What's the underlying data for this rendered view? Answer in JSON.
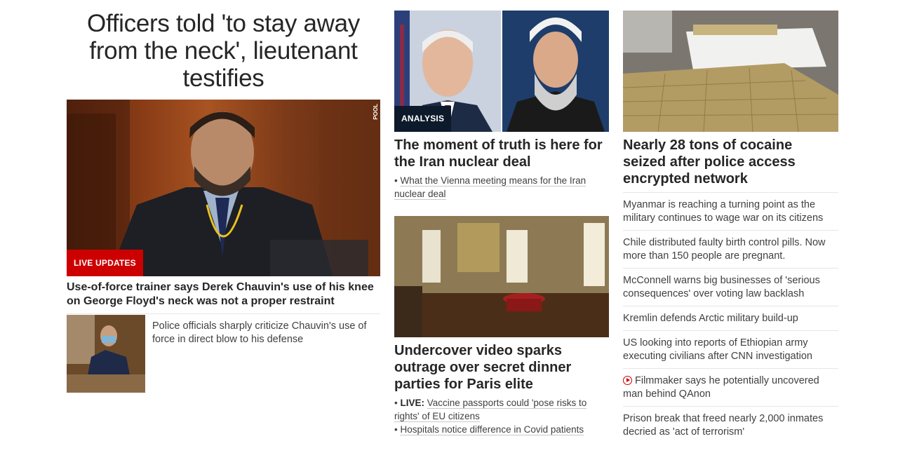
{
  "col1": {
    "headline": "Officers told 'to stay away from the neck', lieutenant testifies",
    "hero_badge": "LIVE UPDATES",
    "pool_label": "POOL",
    "sub_headline": "Use-of-force trainer says Derek Chauvin's use of his knee on George Floyd's neck was not a proper restraint",
    "thumb_text": "Police officials sharply criticize Chauvin's use of force in direct blow to his defense"
  },
  "col2": {
    "iran_badge": "ANALYSIS",
    "iran_headline": "The moment of truth is here for the Iran nuclear deal",
    "iran_bullet": "What the Vienna meeting means for the Iran nuclear deal",
    "paris_headline": "Undercover video sparks outrage over secret dinner parties for Paris elite",
    "paris_bullets": [
      {
        "prefix": "LIVE:",
        "text": "Vaccine passports could 'pose risks to rights' of EU citizens"
      },
      {
        "prefix": "",
        "text": "Hospitals notice difference in Covid patients"
      }
    ]
  },
  "col3": {
    "cocaine_headline": "Nearly 28 tons of cocaine seized after police access encrypted network",
    "items": [
      "Myanmar is reaching a turning point as the military continues to wage war on its citizens",
      "Chile distributed faulty birth control pills. Now more than 150 people are pregnant.",
      "McConnell warns big businesses of 'serious consequences' over voting law backlash",
      "Kremlin defends Arctic military build-up",
      "US looking into reports of Ethiopian army executing civilians after CNN investigation",
      "Filmmaker says he potentially uncovered man behind QAnon",
      "Prison break that freed nearly 2,000 inmates decried as 'act of terrorism'"
    ],
    "video_item_index": 5
  },
  "colors": {
    "live_badge": "#cc0000",
    "analysis_badge": "#0c1a2b",
    "text": "#262626",
    "muted_text": "#404040",
    "video_icon": "#cc0000"
  }
}
